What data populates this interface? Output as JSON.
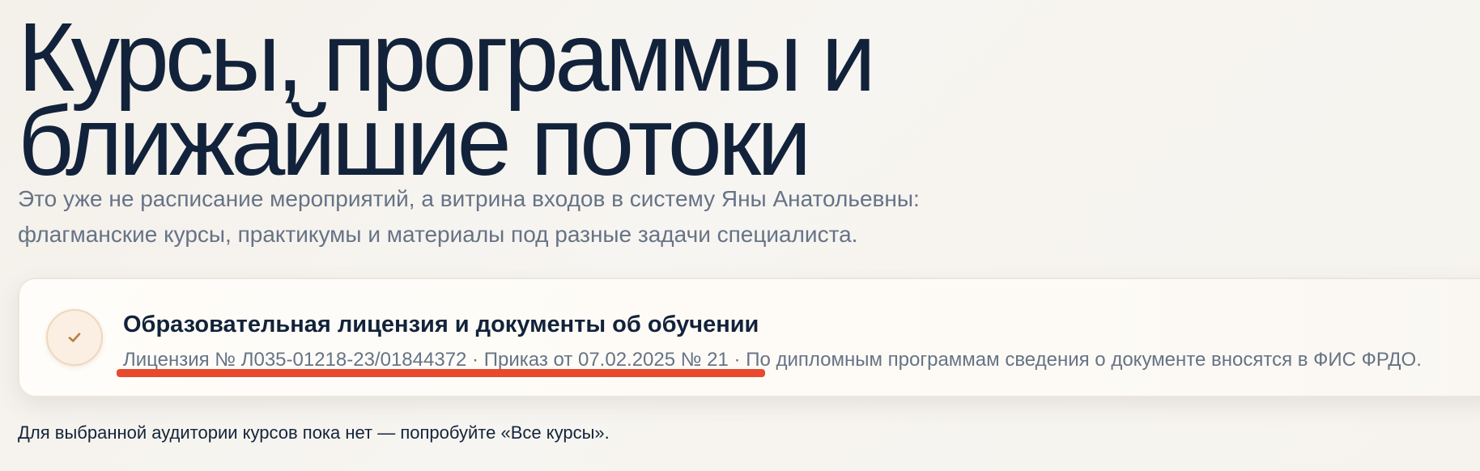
{
  "hero": {
    "title_line_1": "Курсы, программы и",
    "title_line_2": "ближайшие потоки",
    "subtitle_line_1": "Это уже не расписание мероприятий, а витрина входов в систему Яны Анатольевны:",
    "subtitle_line_2": "флагманские курсы, практикумы и материалы под разные задачи специалиста."
  },
  "license_card": {
    "icon": "check-icon",
    "title": "Образовательная лицензия и документы об обучении",
    "license_number": "Лицензия № Л035-01218-23/01844372",
    "separator_1": " · ",
    "order": "Приказ от 07.02.2025 № 21",
    "separator_2": " · ",
    "diploma_note": "По дипломным программам сведения о документе вносятся в ФИС ФРДО.",
    "accent_color": "#b98245",
    "highlight_color": "#e8492f"
  },
  "courses": {
    "empty_message": "Для выбранной аудитории курсов пока нет — попробуйте «Все курсы»."
  }
}
